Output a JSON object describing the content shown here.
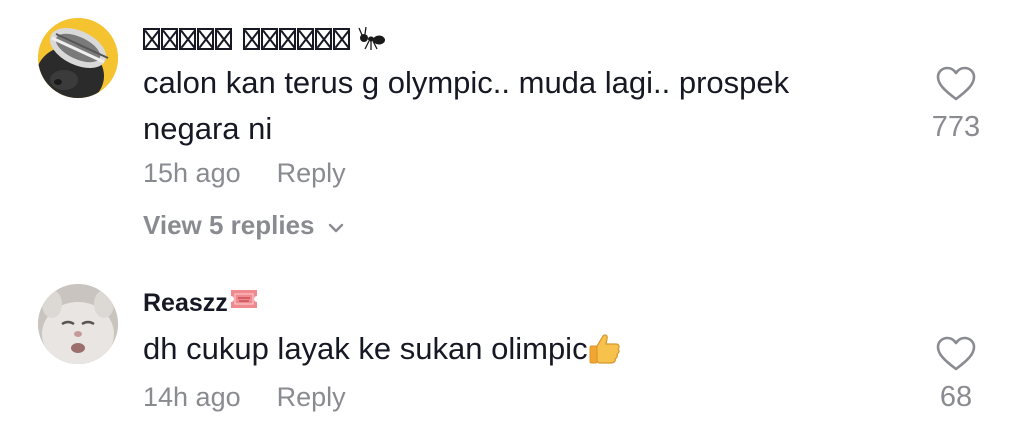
{
  "comments": [
    {
      "username_missing_glyphs": 11,
      "username_emoji": "ant-emoji",
      "text": "calon kan terus g olympic.. muda lagi.. prospek negara ni",
      "time": "15h ago",
      "reply_label": "Reply",
      "like_count": "773",
      "view_replies": "View 5 replies"
    },
    {
      "username": "Reaszz",
      "username_emoji": "admit-one-ticket-emoji",
      "text": "dh cukup layak ke sukan olimpic",
      "text_emoji": "thumbs-up-emoji",
      "time": "14h ago",
      "reply_label": "Reply",
      "like_count": "68"
    }
  ],
  "colors": {
    "primary_text": "#161823",
    "secondary_text": "#8a8b91",
    "avatar_yellow": "#f5c230",
    "ticket_pink": "#f08a8f"
  }
}
